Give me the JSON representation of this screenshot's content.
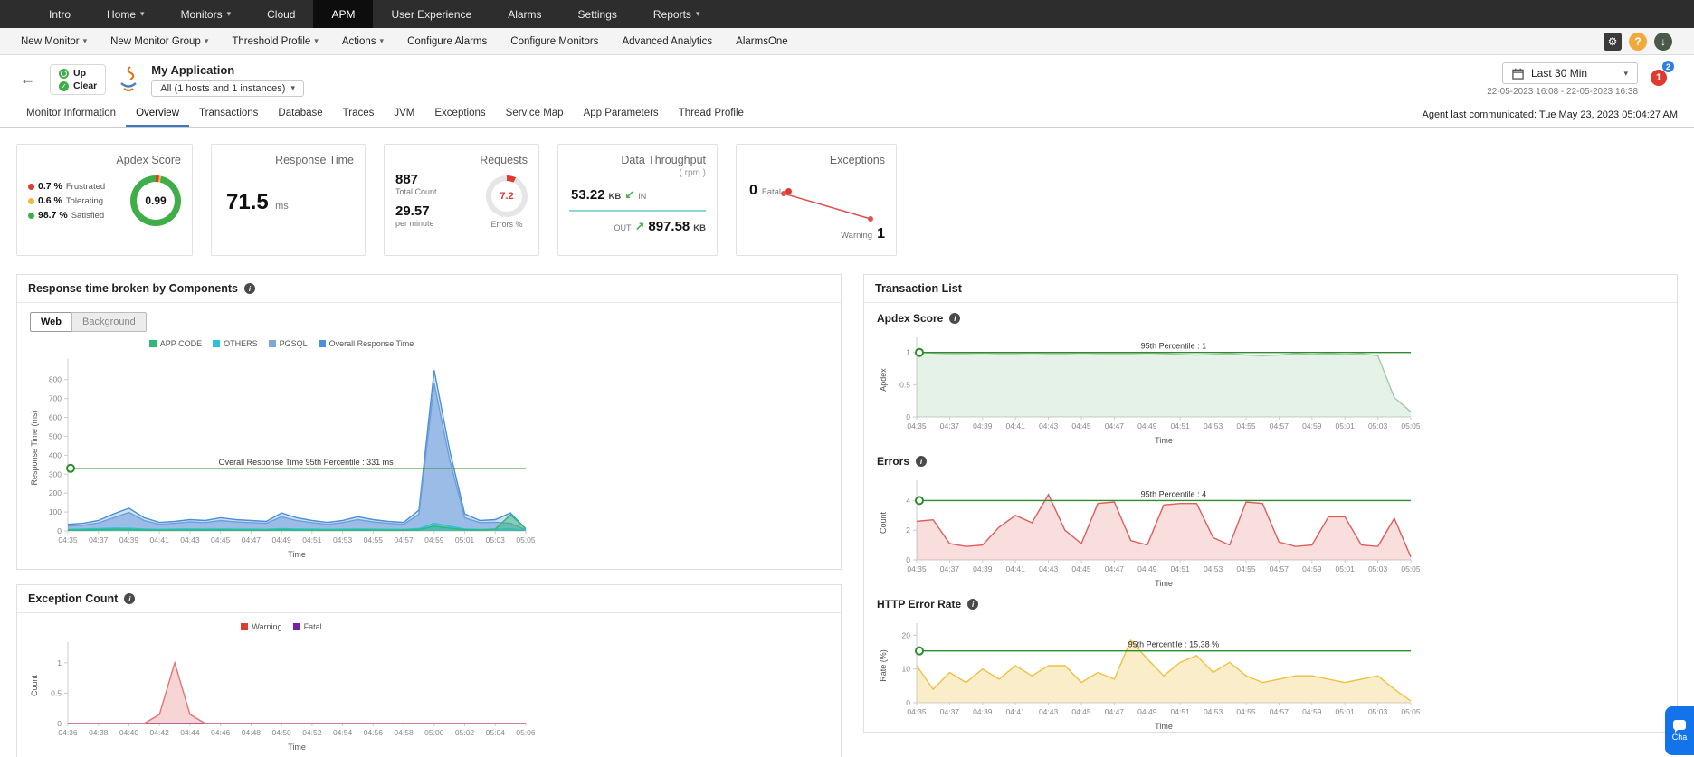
{
  "topnav": {
    "items": [
      {
        "label": "Intro"
      },
      {
        "label": "Home"
      },
      {
        "label": "Monitors"
      },
      {
        "label": "Cloud"
      },
      {
        "label": "APM"
      },
      {
        "label": "User Experience"
      },
      {
        "label": "Alarms"
      },
      {
        "label": "Settings"
      },
      {
        "label": "Reports"
      }
    ]
  },
  "toolbar": {
    "items": [
      {
        "label": "New Monitor"
      },
      {
        "label": "New Monitor Group"
      },
      {
        "label": "Threshold Profile"
      },
      {
        "label": "Actions"
      },
      {
        "label": "Configure Alarms"
      },
      {
        "label": "Configure Monitors"
      },
      {
        "label": "Advanced Analytics"
      },
      {
        "label": "AlarmsOne"
      }
    ]
  },
  "header": {
    "status_up": "Up",
    "status_clear": "Clear",
    "app_title": "My Application",
    "scope_dropdown": "All (1 hosts and 1 instances)",
    "timeframe": "Last 30 Min",
    "time_range": "22-05-2023 16:08 - 22-05-2023 16:38",
    "badge_alarm_count": "1",
    "badge_secondary_count": "2"
  },
  "tabs": {
    "items": [
      "Monitor Information",
      "Overview",
      "Transactions",
      "Database",
      "Traces",
      "JVM",
      "Exceptions",
      "Service Map",
      "App Parameters",
      "Thread Profile"
    ],
    "active": "Overview",
    "agent_text": "Agent last communicated: Tue May 23, 2023 05:04:27 AM"
  },
  "cards": {
    "apdex": {
      "title": "Apdex Score",
      "frustrated_pct": "0.7 %",
      "frustrated_label": "Frustrated",
      "tolerating_pct": "0.6 %",
      "tolerating_label": "Tolerating",
      "satisfied_pct": "98.7 %",
      "satisfied_label": "Satisfied",
      "score": "0.99"
    },
    "response_time": {
      "title": "Response Time",
      "value": "71.5",
      "unit": "ms"
    },
    "requests": {
      "title": "Requests",
      "total": "887",
      "total_label": "Total Count",
      "per_minute": "29.57",
      "per_minute_label": "per minute",
      "errors_pct": "7.2",
      "errors_label": "Errors %"
    },
    "throughput": {
      "title": "Data Throughput",
      "subtitle": "( rpm )",
      "in_value": "53.22",
      "in_unit": "KB",
      "in_label": "IN",
      "out_label": "OUT",
      "out_value": "897.58",
      "out_unit": "KB"
    },
    "exceptions": {
      "title": "Exceptions",
      "fatal_value": "0",
      "fatal_label": "Fatal",
      "warning_label": "Warning",
      "warning_value": "1"
    }
  },
  "panels": {
    "response_components": {
      "title": "Response time broken by Components",
      "toggle_web": "Web",
      "toggle_background": "Background"
    },
    "exception_count": {
      "title": "Exception Count"
    },
    "transaction_list": {
      "title": "Transaction List",
      "sections": [
        "Apdex Score",
        "Errors",
        "HTTP Error Rate"
      ]
    }
  },
  "chat": {
    "label": "Cha"
  },
  "colors": {
    "status_green": "#3fae49",
    "alert_red": "#e03a2f",
    "warning_yellow": "#f1b93c",
    "percentile_green": "#2e8b2e",
    "active_tab_blue": "#3b78c4",
    "chat_blue": "#1273eb"
  },
  "chart_data": [
    {
      "id": "response_components",
      "type": "area",
      "title": "Response time broken by Components",
      "xticks": [
        "04:35",
        "04:37",
        "04:39",
        "04:41",
        "04:43",
        "04:45",
        "04:47",
        "04:49",
        "04:51",
        "04:53",
        "04:55",
        "04:57",
        "04:59",
        "05:01",
        "05:03",
        "05:05"
      ],
      "xtitle": "Time",
      "ytitle": "Response Time (ms)",
      "yticks": [
        0,
        100,
        200,
        300,
        400,
        500,
        600,
        700,
        800
      ],
      "ymax": 880,
      "percentile": {
        "value": 331,
        "label": "Overall Response Time 95th Percentile : 331 ms"
      },
      "legend": [
        {
          "name": "APP CODE",
          "color": "#2eb872"
        },
        {
          "name": "OTHERS",
          "color": "#29c3d7"
        },
        {
          "name": "PGSQL",
          "color": "#7da7d9"
        },
        {
          "name": "Overall Response Time",
          "color": "#4a90d9"
        }
      ],
      "series": [
        {
          "name": "Overall Response Time",
          "color": "#4a90d9",
          "fill": "rgba(116,169,227,0.35)",
          "values": [
            35,
            40,
            55,
            90,
            120,
            70,
            45,
            50,
            60,
            55,
            70,
            60,
            55,
            50,
            95,
            70,
            55,
            45,
            55,
            75,
            60,
            50,
            45,
            110,
            850,
            430,
            90,
            55,
            60,
            95,
            10
          ]
        },
        {
          "name": "PGSQL",
          "color": "#6f9fd8",
          "fill": "rgba(111,159,216,0.55)",
          "values": [
            25,
            30,
            42,
            70,
            98,
            55,
            35,
            40,
            48,
            44,
            55,
            48,
            44,
            40,
            75,
            55,
            44,
            35,
            44,
            60,
            48,
            40,
            35,
            88,
            780,
            380,
            70,
            44,
            46,
            40,
            5
          ]
        },
        {
          "name": "OTHERS",
          "color": "#29c3d7",
          "fill": "rgba(41,195,215,0.45)",
          "values": [
            8,
            10,
            12,
            15,
            14,
            10,
            8,
            9,
            10,
            9,
            10,
            9,
            9,
            8,
            12,
            10,
            9,
            8,
            9,
            10,
            9,
            8,
            8,
            12,
            40,
            25,
            10,
            8,
            8,
            10,
            3
          ]
        },
        {
          "name": "APP CODE",
          "color": "#2eb872",
          "fill": "rgba(46,184,114,0.45)",
          "values": [
            4,
            5,
            6,
            8,
            7,
            5,
            4,
            4,
            5,
            5,
            5,
            5,
            4,
            4,
            6,
            5,
            4,
            4,
            4,
            5,
            5,
            4,
            4,
            6,
            25,
            15,
            6,
            4,
            10,
            85,
            12
          ]
        }
      ]
    },
    {
      "id": "exception_count",
      "type": "area",
      "title": "Exception Count",
      "xticks": [
        "04:36",
        "04:38",
        "04:40",
        "04:42",
        "04:44",
        "04:46",
        "04:48",
        "04:50",
        "04:52",
        "04:54",
        "04:56",
        "04:58",
        "05:00",
        "05:02",
        "05:04",
        "05:06"
      ],
      "xtitle": "Time",
      "ytitle": "Count",
      "yticks": [
        0,
        0.5,
        1
      ],
      "ymax": 1.25,
      "legend": [
        {
          "name": "Warning",
          "color": "#e03a2f"
        },
        {
          "name": "Fatal",
          "color": "#7b1fa2"
        }
      ],
      "series": [
        {
          "name": "Fatal",
          "color": "#7b1fa2",
          "fill": "none",
          "values": [
            0,
            0,
            0,
            0,
            0,
            0,
            0,
            0,
            0,
            0,
            0,
            0,
            0,
            0,
            0,
            0,
            0,
            0,
            0,
            0,
            0,
            0,
            0,
            0,
            0,
            0,
            0,
            0,
            0,
            0,
            0
          ]
        },
        {
          "name": "Warning",
          "color": "#e57373",
          "fill": "rgba(229,115,115,0.3)",
          "values": [
            0,
            0,
            0,
            0,
            0,
            0,
            0.15,
            1,
            0.15,
            0,
            0,
            0,
            0,
            0,
            0,
            0,
            0,
            0,
            0,
            0,
            0,
            0,
            0,
            0,
            0,
            0,
            0,
            0,
            0,
            0,
            0
          ]
        }
      ]
    },
    {
      "id": "apdex_chart",
      "type": "area",
      "title": "Apdex Score",
      "xticks": [
        "04:35",
        "04:37",
        "04:39",
        "04:41",
        "04:43",
        "04:45",
        "04:47",
        "04:49",
        "04:51",
        "04:53",
        "04:55",
        "04:57",
        "04:59",
        "05:01",
        "05:03",
        "05:05"
      ],
      "xtitle": "Time",
      "ytitle": "Apdex",
      "yticks": [
        0,
        0.5,
        1
      ],
      "ymax": 1.15,
      "percentile": {
        "value": 1,
        "label": "95th Percentile : 1"
      },
      "series": [
        {
          "name": "Apdex",
          "color": "#a3c9a3",
          "fill": "rgba(103,183,120,0.18)",
          "values": [
            1,
            0.99,
            0.98,
            0.98,
            0.99,
            0.98,
            0.98,
            0.99,
            0.98,
            0.98,
            0.99,
            0.98,
            0.98,
            0.98,
            0.99,
            0.98,
            0.97,
            0.96,
            0.97,
            0.98,
            0.96,
            0.95,
            0.96,
            0.98,
            0.97,
            0.98,
            0.97,
            0.98,
            0.95,
            0.3,
            0.08
          ]
        }
      ]
    },
    {
      "id": "errors_chart",
      "type": "area",
      "title": "Errors",
      "xticks": [
        "04:35",
        "04:37",
        "04:39",
        "04:41",
        "04:43",
        "04:45",
        "04:47",
        "04:49",
        "04:51",
        "04:53",
        "04:55",
        "04:57",
        "04:59",
        "05:01",
        "05:03",
        "05:05"
      ],
      "xtitle": "Time",
      "ytitle": "Count",
      "yticks": [
        0,
        2,
        4
      ],
      "ymax": 5,
      "percentile": {
        "value": 4,
        "label": "95th Percentile : 4"
      },
      "series": [
        {
          "name": "Errors",
          "color": "#e25c5c",
          "fill": "rgba(226,92,92,0.2)",
          "values": [
            2.6,
            2.7,
            1.1,
            0.9,
            1.0,
            2.2,
            3.0,
            2.5,
            4.4,
            2.0,
            1.1,
            3.8,
            3.9,
            1.3,
            1.0,
            3.7,
            3.8,
            3.8,
            1.5,
            1.0,
            3.9,
            3.8,
            1.2,
            0.9,
            1.0,
            2.9,
            2.9,
            1.0,
            0.9,
            2.8,
            0.2
          ]
        }
      ]
    },
    {
      "id": "http_error_rate",
      "type": "area",
      "title": "HTTP Error Rate",
      "xticks": [
        "04:35",
        "04:37",
        "04:39",
        "04:41",
        "04:43",
        "04:45",
        "04:47",
        "04:49",
        "04:51",
        "04:53",
        "04:55",
        "04:57",
        "04:59",
        "05:01",
        "05:03",
        "05:05"
      ],
      "xtitle": "Time",
      "ytitle": "Rate (%)",
      "yticks": [
        0,
        10,
        20
      ],
      "ymax": 22,
      "percentile": {
        "value": 15.38,
        "label": "95th Percentile : 15.38 %"
      },
      "series": [
        {
          "name": "HTTP Error Rate",
          "color": "#eec13f",
          "fill": "rgba(238,193,63,0.28)",
          "values": [
            11,
            4,
            9,
            6,
            10,
            7,
            11,
            8,
            11,
            11,
            6,
            9,
            7,
            18.5,
            13,
            8,
            12,
            14,
            9,
            12,
            8,
            6,
            7,
            8,
            8,
            7,
            6,
            7,
            8,
            4,
            0.5
          ]
        }
      ]
    }
  ]
}
